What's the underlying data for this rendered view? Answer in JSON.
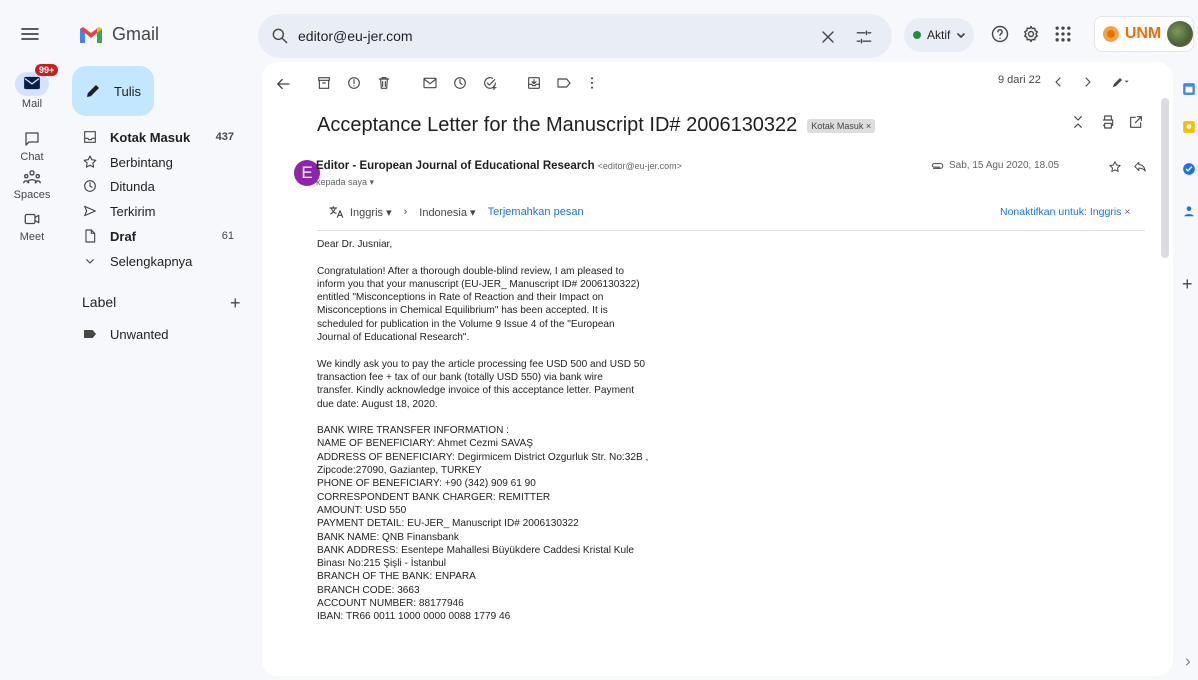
{
  "app": {
    "name": "Gmail"
  },
  "search": {
    "value": "editor@eu-jer.com"
  },
  "status": {
    "label": "Aktif"
  },
  "account": {
    "label": "UNM"
  },
  "rail": {
    "mail_badge": "99+",
    "items": [
      "Mail",
      "Chat",
      "Spaces",
      "Meet"
    ]
  },
  "compose": {
    "label": "Tulis"
  },
  "nav": [
    {
      "label": "Kotak Masuk",
      "count": "437",
      "bold": true
    },
    {
      "label": "Berbintang",
      "count": ""
    },
    {
      "label": "Ditunda",
      "count": ""
    },
    {
      "label": "Terkirim",
      "count": ""
    },
    {
      "label": "Draf",
      "count": "61",
      "bold": true
    },
    {
      "label": "Selengkapnya",
      "count": ""
    }
  ],
  "labels": {
    "heading": "Label",
    "add": "+",
    "items": [
      "Unwanted"
    ]
  },
  "toolbar": {
    "pagination": "9 dari 22"
  },
  "email": {
    "subject": "Acceptance Letter for the Manuscript ID# 2006130322",
    "subject_chip": "Kotak Masuk ×",
    "sender_initial": "E",
    "sender_name": "Editor - European Journal of Educational Research",
    "sender_email": "<editor@eu-jer.com>",
    "to": "kepada saya ▾",
    "date": "Sab, 15 Agu 2020, 18.05",
    "translate": {
      "from": "Inggris ▾",
      "arrow": "›",
      "to": "Indonesia ▾",
      "link": "Terjemahkan pesan",
      "off": "Nonaktifkan untuk: Inggris",
      "off_x": "×"
    },
    "body": [
      [
        "Dear Dr.  Jusniar,"
      ],
      [
        "Congratulation! After a thorough double-blind review, I am pleased to",
        "inform you that your manuscript (EU-JER_ Manuscript ID# 2006130322)",
        "entitled \"Misconceptions in Rate of Reaction and their Impact on",
        "Misconceptions in Chemical Equilibrium\" has been accepted. It is",
        "scheduled for publication in the Volume 9 Issue 4 of the \"European",
        "Journal of Educational Research\"."
      ],
      [
        "We kindly ask you to pay the article processing fee USD 500 and USD 50",
        "transaction fee + tax of our bank (totally USD 550) via bank wire",
        "transfer. Kindly acknowledge invoice of this acceptance letter. Payment",
        "due date: August 18, 2020."
      ],
      [
        "BANK WIRE TRANSFER INFORMATION :",
        "NAME OF BENEFICIARY:   Ahmet Cezmi SAVAŞ",
        "ADDRESS OF BENEFICIARY:   Degirmicem District Ozgurluk Str. No:32B ,",
        "Zipcode:27090, Gaziantep, TURKEY",
        "PHONE OF BENEFICIARY:   +90 (342) 909 61 90",
        "CORRESPONDENT BANK CHARGER:   REMITTER",
        "AMOUNT:   USD 550",
        "PAYMENT DETAIL:   EU-JER_ Manuscript ID# 2006130322",
        "BANK NAME:   QNB Finansbank",
        "BANK ADDRESS:   Esentepe Mahallesi Büyükdere Caddesi Kristal Kule",
        "Binası No:215 Şişli - İstanbul",
        "BRANCH OF THE BANK:   ENPARA",
        "BRANCH CODE:   3663",
        "ACCOUNT NUMBER:   88177946",
        "IBAN:   TR66 0011 1000 0000 0088 1779 46"
      ]
    ]
  },
  "right_rail": {
    "add": "+"
  },
  "colors": {
    "accent": "#1a73e8",
    "compose": "#c2e7ff",
    "avatar": "#8e24aa",
    "badge": "#c5221f",
    "status": "#1e8e3e"
  }
}
